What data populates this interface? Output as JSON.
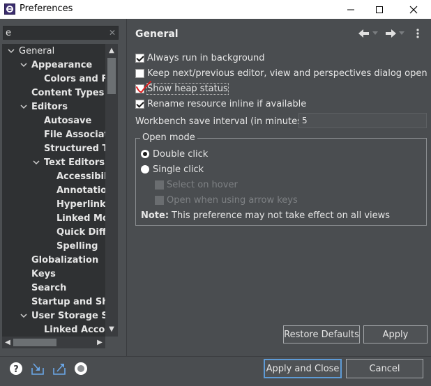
{
  "window": {
    "title": "Preferences"
  },
  "filter": {
    "value": "e"
  },
  "tree": {
    "items": [
      {
        "label": "General",
        "expanded": true
      },
      {
        "label": "Appearance",
        "expanded": true
      },
      {
        "label": "Colors and Fo"
      },
      {
        "label": "Content Types"
      },
      {
        "label": "Editors",
        "expanded": true
      },
      {
        "label": "Autosave"
      },
      {
        "label": "File Associatic"
      },
      {
        "label": "Structured Tex"
      },
      {
        "label": "Text Editors",
        "expanded": true
      },
      {
        "label": "Accessibility"
      },
      {
        "label": "Annotation"
      },
      {
        "label": "Hyperlinkin"
      },
      {
        "label": "Linked Moc"
      },
      {
        "label": "Quick Diff"
      },
      {
        "label": "Spelling"
      },
      {
        "label": "Globalization"
      },
      {
        "label": "Keys"
      },
      {
        "label": "Search"
      },
      {
        "label": "Startup and Shut"
      },
      {
        "label": "User Storage Serv",
        "expanded": true
      },
      {
        "label": "Linked Accour"
      }
    ]
  },
  "page": {
    "title": "General",
    "options": {
      "always_run_background": {
        "label": "Always run in background",
        "checked": true
      },
      "keep_next_prev": {
        "label": "Keep next/previous editor, view and perspectives dialog open",
        "checked": false
      },
      "show_heap_status": {
        "label": "Show heap status",
        "checked": false
      },
      "rename_inline": {
        "label": "Rename resource inline if available",
        "checked": true
      }
    },
    "interval": {
      "label": "Workbench save interval (in minutes):",
      "value": "5"
    },
    "open_mode": {
      "label": "Open mode",
      "double_click": "Double click",
      "single_click": "Single click",
      "select_on_hover": "Select on hover",
      "open_arrow_keys": "Open when using arrow keys",
      "selected": "double_click"
    },
    "note": {
      "prefix": "Note:",
      "text": "This preference may not take effect on all views"
    }
  },
  "buttons": {
    "restore_defaults": "Restore Defaults",
    "apply": "Apply",
    "apply_and_close": "Apply and Close",
    "cancel": "Cancel"
  },
  "icons": {
    "help": "help-icon",
    "import": "import-icon",
    "export": "export-icon",
    "record": "record-icon"
  },
  "colors": {
    "accent": "#5e9bd6",
    "background": "#4a4d50",
    "tree_background": "#2f3133",
    "text": "#e6e6e6",
    "annotation_red": "#e02020"
  }
}
